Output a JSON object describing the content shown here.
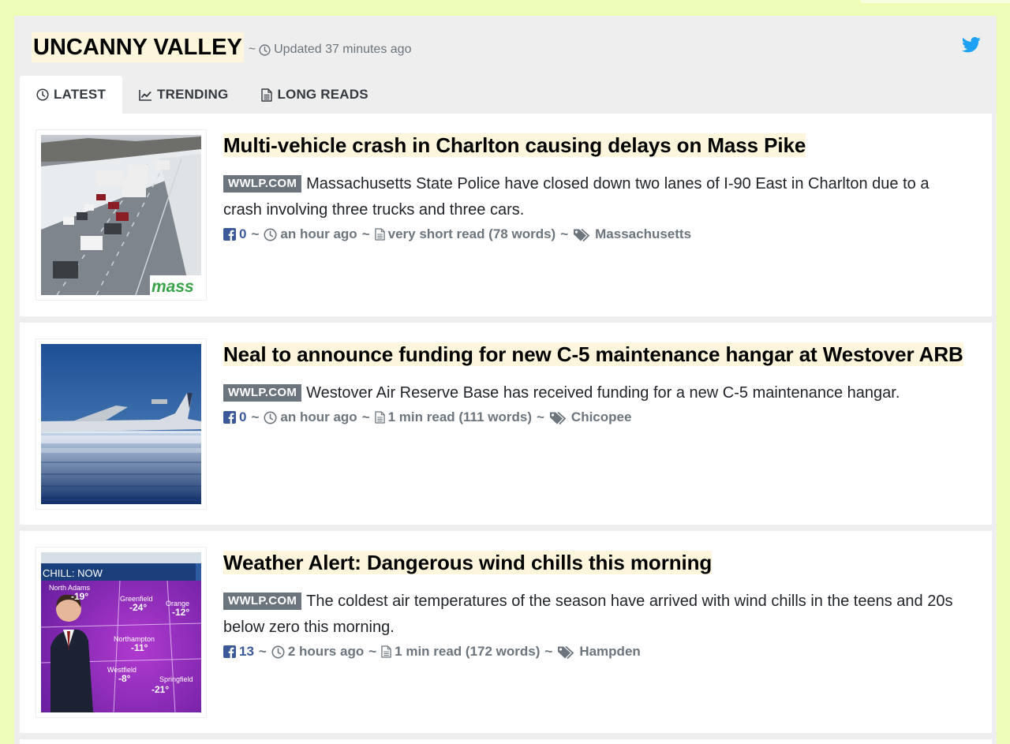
{
  "site": {
    "title": "UNCANNY VALLEY",
    "separator": "~",
    "updated": "Updated 37 minutes ago"
  },
  "tabs": [
    {
      "label": "LATEST",
      "icon": "clock-icon",
      "active": true
    },
    {
      "label": "TRENDING",
      "icon": "chart-line-icon",
      "active": false
    },
    {
      "label": "LONG READS",
      "icon": "file-icon",
      "active": false
    }
  ],
  "articles": [
    {
      "title": "Multi-vehicle crash in Charlton causing delays on Mass Pike",
      "source": "WWLP.COM",
      "summary": "Massachusetts State Police have closed down two lanes of I-90 East in Charlton due to a crash involving three trucks and three cars.",
      "fb_count": "0",
      "time": "an hour ago",
      "read": "very short read (78 words)",
      "tag": "Massachusetts",
      "thumb_text": "mass"
    },
    {
      "title": "Neal to announce funding for new C-5 maintenance hangar at Westover ARB",
      "source": "WWLP.COM",
      "summary": "Westover Air Reserve Base has received funding for a new C-5 maintenance hangar.",
      "fb_count": "0",
      "time": "an hour ago",
      "read": "1 min read (111 words)",
      "tag": "Chicopee"
    },
    {
      "title": "Weather Alert: Dangerous wind chills this morning",
      "source": "WWLP.COM",
      "summary": "The coldest air temperatures of the season have arrived with wind chills in the teens and 20s below zero this morning.",
      "fb_count": "13",
      "time": "2 hours ago",
      "read": "1 min read (172 words)",
      "tag": "Hampden",
      "thumb_map": {
        "header": "CHILL: NOW",
        "places": [
          {
            "name": "North Adams",
            "temp": "-19°"
          },
          {
            "name": "Greenfield",
            "temp": "-24°"
          },
          {
            "name": "Orange",
            "temp": "-12°"
          },
          {
            "name": "Northampton",
            "temp": "-11°"
          },
          {
            "name": "Westfield",
            "temp": "-8°"
          },
          {
            "name": "Springfield",
            "temp": "-21°"
          }
        ]
      }
    }
  ],
  "colors": {
    "page_background": "#eefdb5",
    "title_highlight": "#fdf6dc",
    "source_badge": "#6c757d",
    "facebook": "#3b5998",
    "twitter": "#1da1f2"
  }
}
